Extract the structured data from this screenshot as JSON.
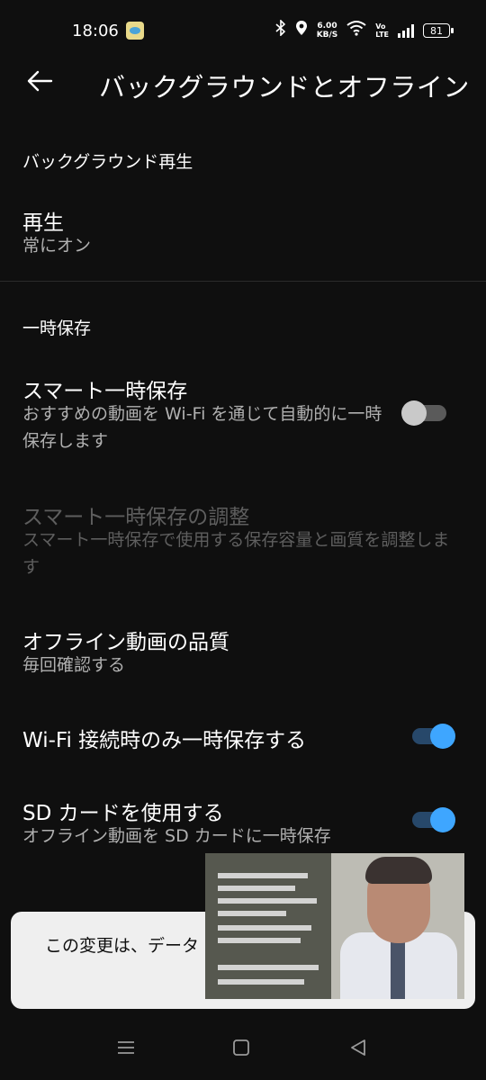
{
  "status_bar": {
    "time": "18:06",
    "speed_value": "6.00",
    "speed_unit": "KB/S",
    "volte_top": "Vo",
    "volte_bottom": "LTE",
    "battery": "81"
  },
  "header": {
    "title": "バックグラウンドとオフライン"
  },
  "sections": {
    "background_play": {
      "header": "バックグラウンド再生",
      "playback_title": "再生",
      "playback_value": "常にオン"
    },
    "downloads": {
      "header": "一時保存",
      "smart_download": {
        "title": "スマート一時保存",
        "subtitle": "おすすめの動画を Wi-Fi を通じて自動的に一時保存します",
        "toggle": "off"
      },
      "smart_download_adjust": {
        "title": "スマート一時保存の調整",
        "subtitle": "スマート一時保存で使用する保存容量と画質を調整します"
      },
      "offline_quality": {
        "title": "オフライン動画の品質",
        "value": "毎回確認する"
      },
      "wifi_only": {
        "title": "Wi-Fi 接続時のみ一時保存する",
        "toggle": "on"
      },
      "sd_card": {
        "title": "SD カードを使用する",
        "subtitle": "オフライン動画を SD カードに一時保存",
        "toggle": "on"
      }
    }
  },
  "snackbar": {
    "text": "この変更は、データ ます"
  },
  "colors": {
    "background": "#0f0f0f",
    "toggle_on": "#3ea6ff",
    "toggle_on_track": "#27486a",
    "toggle_off_knob": "#c9c9c9",
    "disabled_text": "#5e5e5e",
    "snackbar_bg": "#efefef"
  },
  "icons": {
    "back": "arrow-left-icon",
    "bluetooth": "bluetooth-icon",
    "location": "location-pin-icon",
    "wifi": "wifi-icon",
    "signal": "signal-bars-icon",
    "nav_menu": "menu-lines-icon",
    "nav_home": "square-home-icon",
    "nav_back": "triangle-back-icon"
  }
}
